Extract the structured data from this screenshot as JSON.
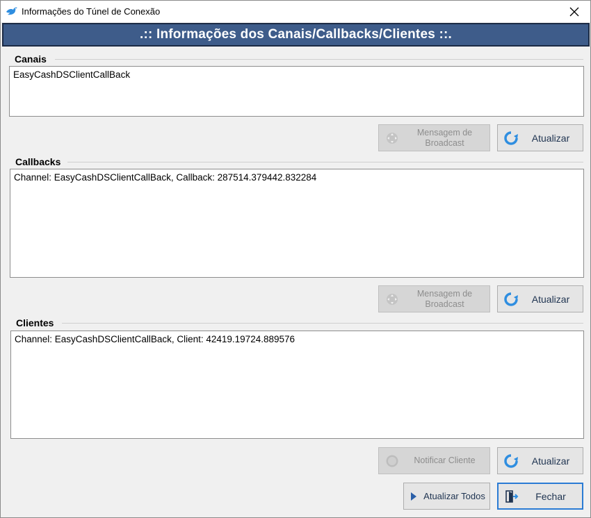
{
  "window": {
    "title": "Informações do Túnel de Conexão"
  },
  "header": {
    "title": ".:: Informações dos Canais/Callbacks/Clientes ::."
  },
  "canais": {
    "label": "Canais",
    "items": [
      "EasyCashDSClientCallBack"
    ],
    "broadcast_button": "Mensagem de Broadcast",
    "refresh_button": "Atualizar"
  },
  "callbacks": {
    "label": "Callbacks",
    "items": [
      "Channel: EasyCashDSClientCallBack, Callback: 287514.379442.832284"
    ],
    "broadcast_button": "Mensagem de Broadcast",
    "refresh_button": "Atualizar"
  },
  "clientes": {
    "label": "Clientes",
    "items": [
      "Channel: EasyCashDSClientCallBack, Client: 42419.19724.889576"
    ],
    "notify_button": "Notificar Cliente",
    "refresh_button": "Atualizar"
  },
  "footer": {
    "refresh_all_button": "Atualizar Todos",
    "close_button": "Fechar"
  },
  "colors": {
    "header_bg": "#3e5c8a",
    "primary_border": "#2a7bd4",
    "refresh_icon": "#2f8ee0"
  },
  "icons": {
    "app": "bird-icon",
    "close": "close-icon",
    "broadcast": "move-arrows-icon",
    "refresh": "refresh-icon",
    "notify": "notify-icon",
    "refresh_all": "play-icon",
    "exit": "exit-door-icon"
  }
}
